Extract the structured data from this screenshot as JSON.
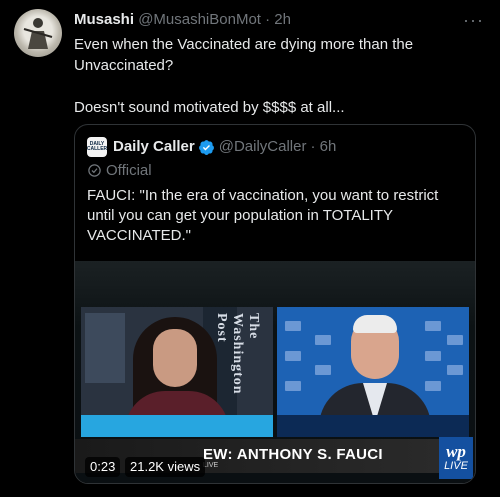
{
  "author": {
    "display_name": "Musashi",
    "handle": "@MusashiBonMot",
    "time": "· 2h"
  },
  "tweet": {
    "line1": "Even when the Vaccinated are dying more than the Unvaccinated?",
    "line2": "Doesn't sound motivated by $$$$ at all..."
  },
  "quoted": {
    "logo_line1": "DAILY",
    "logo_line2": "CALLER",
    "display_name": "Daily Caller",
    "handle": "@DailyCaller",
    "time": "· 6h",
    "label": "Official",
    "text": "FAUCI: \"In the era of vaccination, you want to restrict until you can get your population in TOTALITY VACCINATED.\""
  },
  "video": {
    "sign_text": "The Washington Post",
    "lower_third_title": "EW: ANTHONY S. FAUCI",
    "lower_third_sub": "LIVE",
    "badge_logo": "wp",
    "badge_label": "LIVE",
    "timestamp": "0:23",
    "views": "21.2K views"
  },
  "colors": {
    "background": "#000000",
    "muted": "#71767b",
    "verified": "#1d9bf0"
  }
}
